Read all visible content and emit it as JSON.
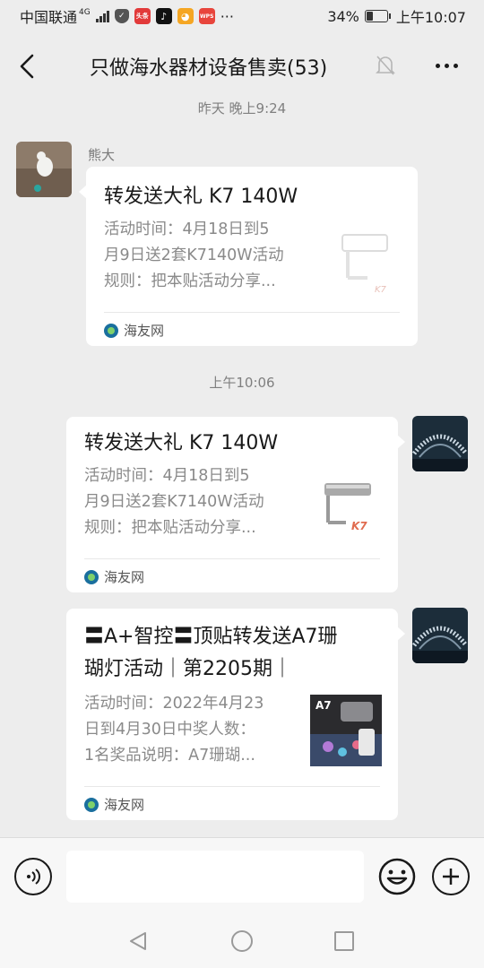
{
  "status_bar": {
    "carrier": "中国联通",
    "network": "4G",
    "app_badges": [
      {
        "name": "toutiao-icon",
        "text": "头条",
        "color": "#e23a3a"
      },
      {
        "name": "tiktok-icon",
        "text": "♪",
        "color": "#111111"
      },
      {
        "name": "orange-app-icon",
        "text": "◕",
        "color": "#f5a623"
      },
      {
        "name": "wps-icon",
        "text": "WPS",
        "color": "#e8453c"
      }
    ],
    "more": "···",
    "battery": "34%",
    "battery_level": 0.34,
    "time": "上午10:07"
  },
  "header": {
    "title": "只做海水器材设备售卖(53)"
  },
  "messages": {
    "time_1": "昨天 晚上9:24",
    "time_2": "上午10:06",
    "sender_1": "熊大",
    "cards": [
      {
        "title": "转发送大礼 K7 140W",
        "desc_lines": [
          "活动时间：4月18日到5",
          "月9日送2套K7140W活动",
          "规则：把本贴活动分享..."
        ],
        "thumb_label": "K7",
        "source": "海友网"
      },
      {
        "title": "转发送大礼 K7 140W",
        "desc_lines": [
          "活动时间：4月18日到5",
          "月9日送2套K7140W活动",
          "规则：把本贴活动分享..."
        ],
        "thumb_label": "K7",
        "source": "海友网"
      },
      {
        "title_lines": [
          "〓A+智控〓顶贴转发送A7珊",
          "瑚灯活动｜第2205期｜"
        ],
        "desc_lines": [
          "活动时间：2022年4月23",
          "日到4月30日中奖人数：",
          "1名奖品说明：A7珊瑚..."
        ],
        "thumb_label": "A7",
        "source": "海友网"
      }
    ]
  },
  "input": {
    "placeholder": ""
  },
  "colors": {
    "background": "#ededed",
    "card": "#ffffff",
    "muted_text": "#8a8a8a"
  }
}
